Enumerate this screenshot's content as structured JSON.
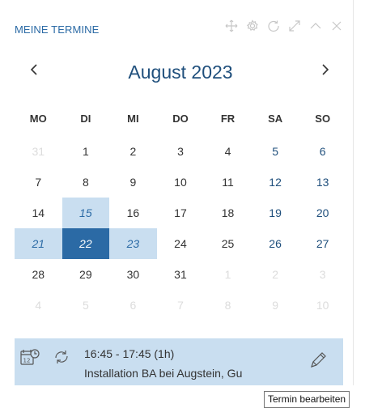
{
  "widget": {
    "title": "MEINE TERMINE",
    "tools": [
      "move-icon",
      "gear-icon",
      "refresh-icon",
      "expand-icon",
      "collapse-icon",
      "close-icon"
    ]
  },
  "calendar": {
    "month_label": "August 2023",
    "weekdays": [
      "MO",
      "DI",
      "MI",
      "DO",
      "FR",
      "SA",
      "SO"
    ],
    "weeks": [
      [
        "31",
        "1",
        "2",
        "3",
        "4",
        "5",
        "6"
      ],
      [
        "7",
        "8",
        "9",
        "10",
        "11",
        "12",
        "13"
      ],
      [
        "14",
        "15",
        "16",
        "17",
        "18",
        "19",
        "20"
      ],
      [
        "21",
        "22",
        "23",
        "24",
        "25",
        "26",
        "27"
      ],
      [
        "28",
        "29",
        "30",
        "31",
        "1",
        "2",
        "3"
      ],
      [
        "4",
        "5",
        "6",
        "7",
        "8",
        "9",
        "10"
      ]
    ]
  },
  "appointment": {
    "time": "16:45 - 17:45 (1h)",
    "description": "Installation BA bei Augstein, Gu"
  },
  "tooltip": {
    "text": "Termin bearbeiten"
  },
  "colors": {
    "accent": "#2b6aa5",
    "selection": "#c9def0",
    "weekend": "#1f4f7c"
  }
}
